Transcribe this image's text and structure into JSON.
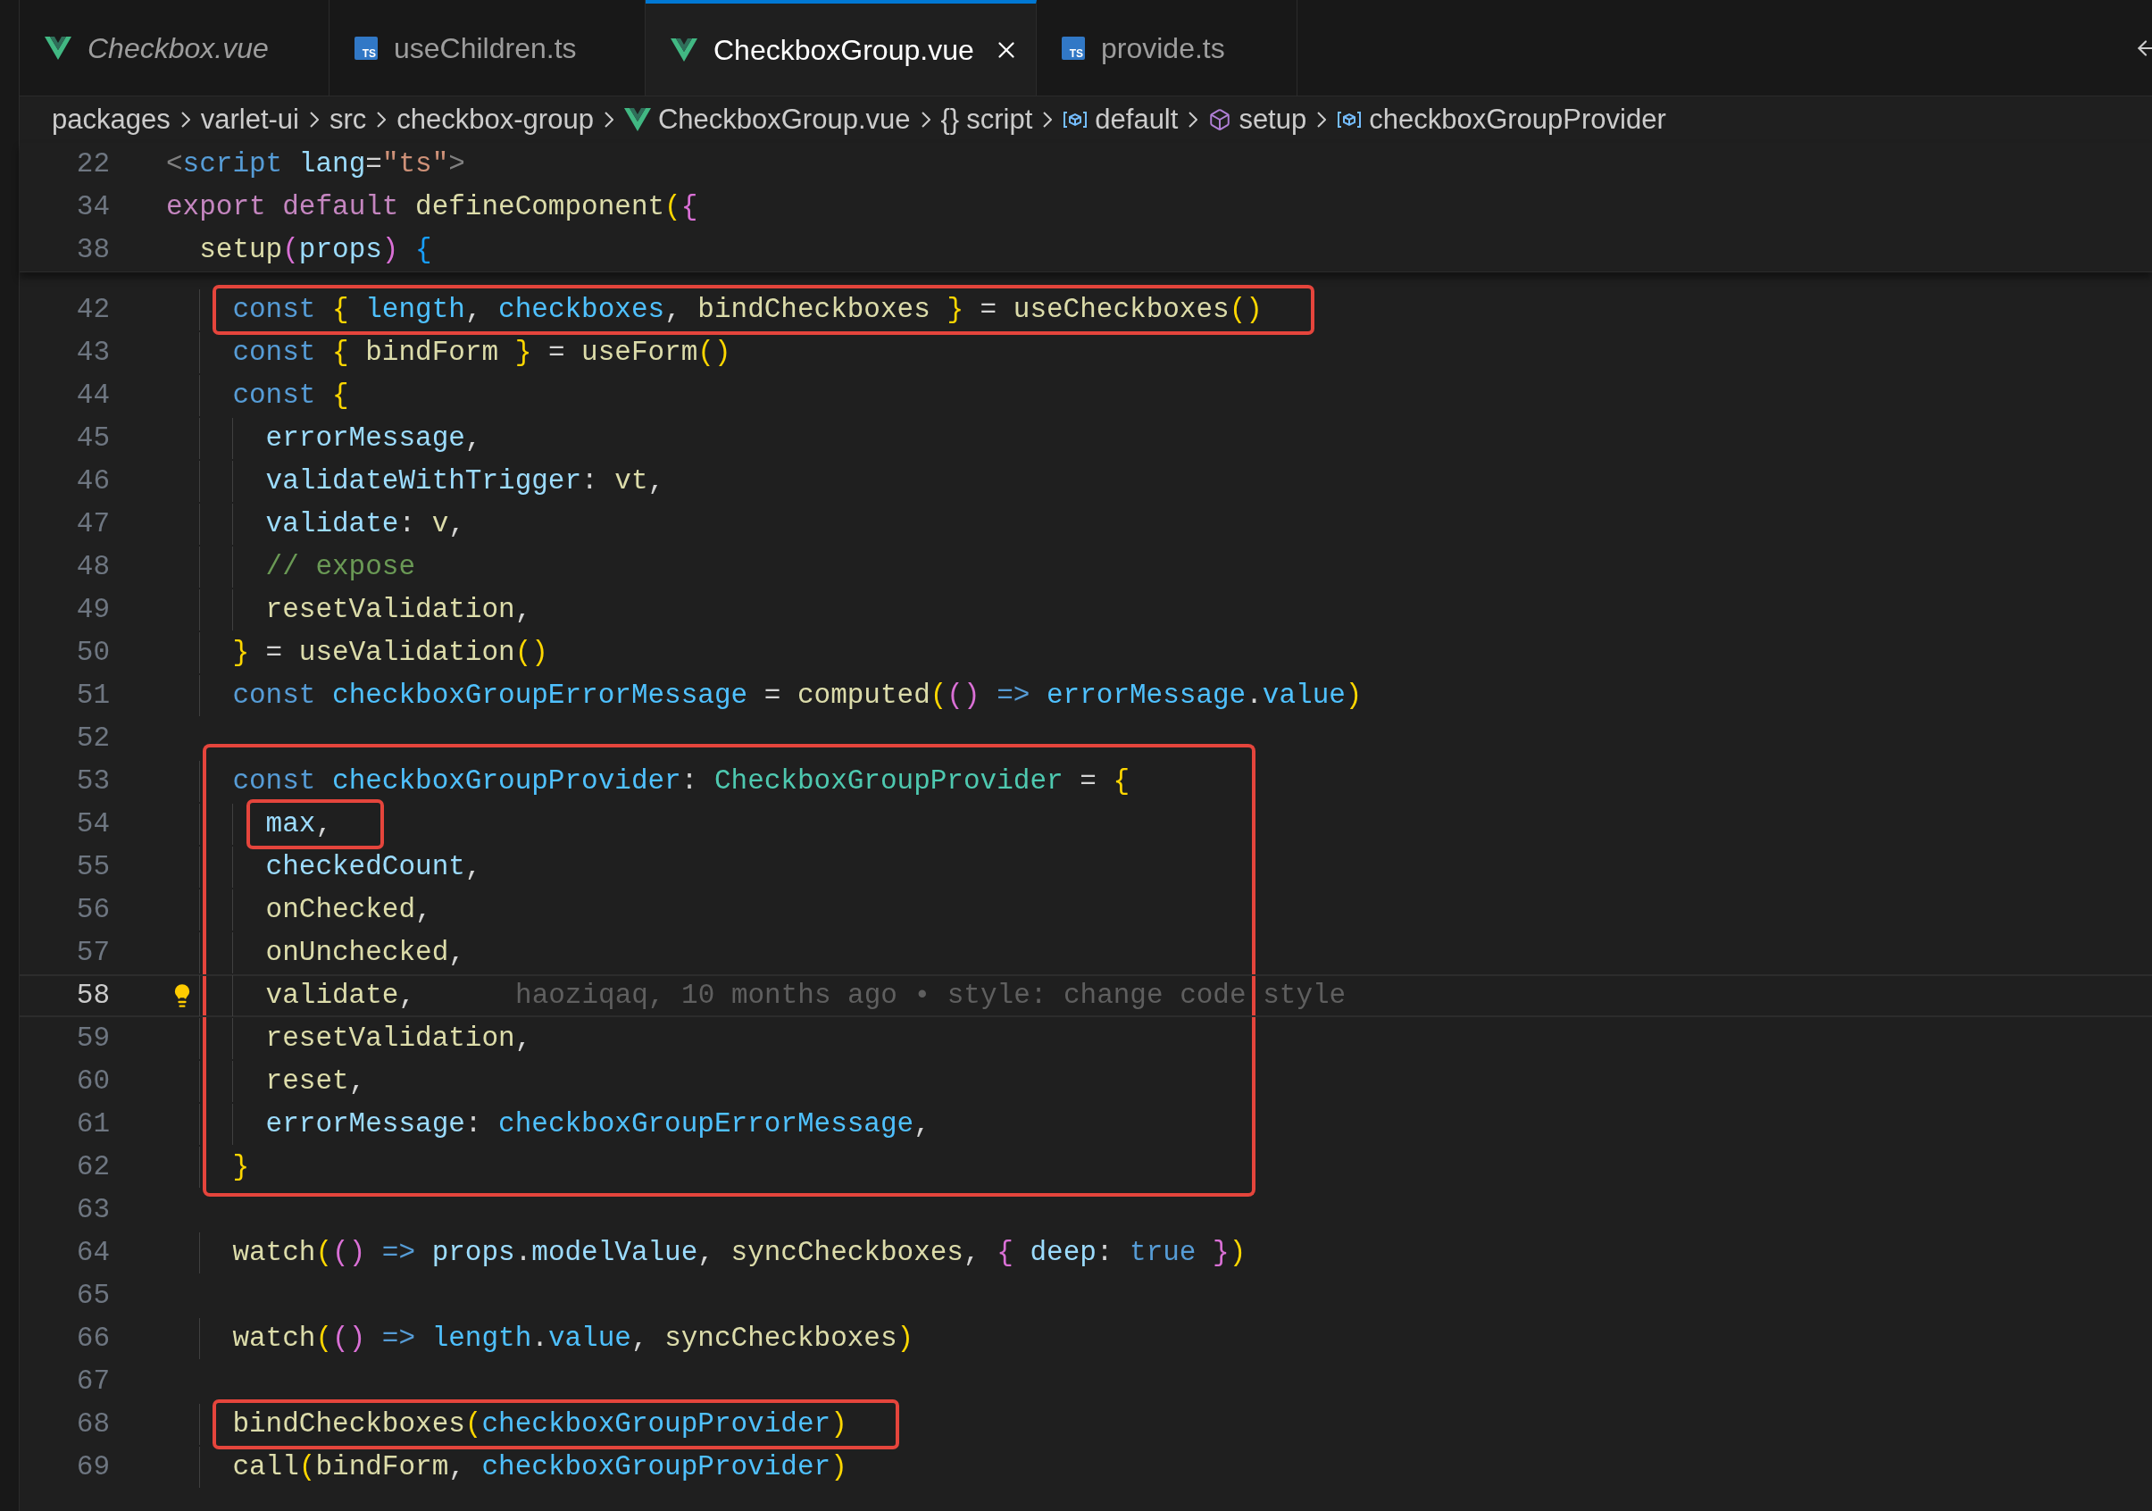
{
  "tabs": [
    {
      "label": "Checkbox.vue",
      "kind": "vue",
      "selected": false,
      "preview": true
    },
    {
      "label": "useChildren.ts",
      "kind": "ts",
      "icon_text": "TS",
      "selected": false,
      "preview": false
    },
    {
      "label": "CheckboxGroup.vue",
      "kind": "vue",
      "selected": true,
      "preview": false
    },
    {
      "label": "provide.ts",
      "kind": "ts",
      "icon_text": "TS",
      "selected": false,
      "preview": false
    }
  ],
  "breadcrumbs": [
    {
      "label": "packages",
      "kind": "folder"
    },
    {
      "label": "varlet-ui",
      "kind": "folder"
    },
    {
      "label": "src",
      "kind": "folder"
    },
    {
      "label": "checkbox-group",
      "kind": "folder"
    },
    {
      "label": "CheckboxGroup.vue",
      "kind": "vue"
    },
    {
      "label": "script",
      "kind": "block",
      "icon_text": "{}"
    },
    {
      "label": "default",
      "kind": "variable"
    },
    {
      "label": "setup",
      "kind": "method"
    },
    {
      "label": "checkboxGroupProvider",
      "kind": "variable"
    }
  ],
  "sticky_lines": [
    {
      "number": "22",
      "tokens": [
        {
          "text": "<",
          "kind": "tagp"
        },
        {
          "text": "script ",
          "kind": "kw"
        },
        {
          "text": "lang",
          "kind": "prop"
        },
        {
          "text": "=",
          "kind": "p"
        },
        {
          "text": "\"ts\"",
          "kind": "str"
        },
        {
          "text": ">",
          "kind": "tagp"
        }
      ]
    },
    {
      "number": "34",
      "tokens": [
        {
          "text": "export default ",
          "kind": "ctl"
        },
        {
          "text": "defineComponent",
          "kind": "fn"
        },
        {
          "text": "(",
          "kind": "b1"
        },
        {
          "text": "{",
          "kind": "b2"
        }
      ]
    },
    {
      "number": "38",
      "tokens": [
        {
          "text": "  setup",
          "kind": "fn"
        },
        {
          "text": "(",
          "kind": "b2"
        },
        {
          "text": "props",
          "kind": "prop"
        },
        {
          "text": ") ",
          "kind": "b2"
        },
        {
          "text": "{",
          "kind": "b3"
        }
      ]
    }
  ],
  "lines": [
    {
      "number": "42",
      "current": false,
      "marked": true,
      "in_frame": false,
      "tokens": [
        {
          "text": "    const ",
          "kind": "kw"
        },
        {
          "text": "{ ",
          "kind": "b1"
        },
        {
          "text": "length",
          "kind": "var"
        },
        {
          "text": ", ",
          "kind": "p"
        },
        {
          "text": "checkboxes",
          "kind": "var"
        },
        {
          "text": ", ",
          "kind": "p"
        },
        {
          "text": "bindCheckboxes ",
          "kind": "fn"
        },
        {
          "text": "}",
          "kind": "b1"
        },
        {
          "text": " = ",
          "kind": "p"
        },
        {
          "text": "useCheckboxes",
          "kind": "fn"
        },
        {
          "text": "()",
          "kind": "b1"
        }
      ]
    },
    {
      "number": "43",
      "current": false,
      "marked": false,
      "in_frame": false,
      "tokens": [
        {
          "text": "    const ",
          "kind": "kw"
        },
        {
          "text": "{ ",
          "kind": "b1"
        },
        {
          "text": "bindForm ",
          "kind": "fn"
        },
        {
          "text": "}",
          "kind": "b1"
        },
        {
          "text": " = ",
          "kind": "p"
        },
        {
          "text": "useForm",
          "kind": "fn"
        },
        {
          "text": "()",
          "kind": "b1"
        }
      ]
    },
    {
      "number": "44",
      "current": false,
      "marked": false,
      "in_frame": false,
      "tokens": [
        {
          "text": "    const ",
          "kind": "kw"
        },
        {
          "text": "{",
          "kind": "b1"
        }
      ]
    },
    {
      "number": "45",
      "current": false,
      "marked": false,
      "in_frame": false,
      "tokens": [
        {
          "text": "      errorMessage",
          "kind": "prop"
        },
        {
          "text": ",",
          "kind": "p"
        }
      ]
    },
    {
      "number": "46",
      "current": false,
      "marked": false,
      "in_frame": false,
      "tokens": [
        {
          "text": "      validateWithTrigger",
          "kind": "prop"
        },
        {
          "text": ": ",
          "kind": "p"
        },
        {
          "text": "vt",
          "kind": "fn"
        },
        {
          "text": ",",
          "kind": "p"
        }
      ]
    },
    {
      "number": "47",
      "current": false,
      "marked": false,
      "in_frame": false,
      "tokens": [
        {
          "text": "      validate",
          "kind": "prop"
        },
        {
          "text": ": ",
          "kind": "p"
        },
        {
          "text": "v",
          "kind": "fn"
        },
        {
          "text": ",",
          "kind": "p"
        }
      ]
    },
    {
      "number": "48",
      "current": false,
      "marked": false,
      "in_frame": false,
      "tokens": [
        {
          "text": "      // expose",
          "kind": "cm"
        }
      ]
    },
    {
      "number": "49",
      "current": false,
      "marked": false,
      "in_frame": false,
      "tokens": [
        {
          "text": "      resetValidation",
          "kind": "fn"
        },
        {
          "text": ",",
          "kind": "p"
        }
      ]
    },
    {
      "number": "50",
      "current": false,
      "marked": false,
      "in_frame": false,
      "tokens": [
        {
          "text": "    }",
          "kind": "b1"
        },
        {
          "text": " = ",
          "kind": "p"
        },
        {
          "text": "useValidation",
          "kind": "fn"
        },
        {
          "text": "()",
          "kind": "b1"
        }
      ]
    },
    {
      "number": "51",
      "current": false,
      "marked": false,
      "in_frame": false,
      "tokens": [
        {
          "text": "    const ",
          "kind": "kw"
        },
        {
          "text": "checkboxGroupErrorMessage",
          "kind": "var"
        },
        {
          "text": " = ",
          "kind": "p"
        },
        {
          "text": "computed",
          "kind": "fn"
        },
        {
          "text": "(",
          "kind": "b1"
        },
        {
          "text": "() ",
          "kind": "b2"
        },
        {
          "text": "=> ",
          "kind": "kw"
        },
        {
          "text": "errorMessage",
          "kind": "var"
        },
        {
          "text": ".",
          "kind": "p"
        },
        {
          "text": "value",
          "kind": "var"
        },
        {
          "text": ")",
          "kind": "b1"
        }
      ]
    },
    {
      "number": "52",
      "current": false,
      "marked": false,
      "in_frame": false
    },
    {
      "number": "53",
      "current": false,
      "marked": false,
      "in_frame": true,
      "tokens": [
        {
          "text": "    const ",
          "kind": "kw"
        },
        {
          "text": "checkboxGroupProvider",
          "kind": "var"
        },
        {
          "text": ": ",
          "kind": "p"
        },
        {
          "text": "CheckboxGroupProvider",
          "kind": "type"
        },
        {
          "text": " = ",
          "kind": "p"
        },
        {
          "text": "{",
          "kind": "b1"
        }
      ]
    },
    {
      "number": "54",
      "current": false,
      "marked": true,
      "in_frame": true,
      "tokens": [
        {
          "text": "      max",
          "kind": "prop"
        },
        {
          "text": ",",
          "kind": "p"
        }
      ]
    },
    {
      "number": "55",
      "current": false,
      "marked": false,
      "in_frame": true,
      "tokens": [
        {
          "text": "      checkedCount",
          "kind": "prop"
        },
        {
          "text": ",",
          "kind": "p"
        }
      ]
    },
    {
      "number": "56",
      "current": false,
      "marked": false,
      "in_frame": true,
      "tokens": [
        {
          "text": "      onChecked",
          "kind": "fn"
        },
        {
          "text": ",",
          "kind": "p"
        }
      ]
    },
    {
      "number": "57",
      "current": false,
      "marked": false,
      "in_frame": true,
      "tokens": [
        {
          "text": "      onUnchecked",
          "kind": "fn"
        },
        {
          "text": ",",
          "kind": "p"
        }
      ]
    },
    {
      "number": "58",
      "current": true,
      "marked": false,
      "in_frame": true,
      "blame": "haoziqaq, 10 months ago • style: change code style",
      "tokens": [
        {
          "text": "      validate",
          "kind": "fn"
        },
        {
          "text": ",",
          "kind": "p"
        }
      ]
    },
    {
      "number": "59",
      "current": false,
      "marked": false,
      "in_frame": true,
      "tokens": [
        {
          "text": "      resetValidation",
          "kind": "fn"
        },
        {
          "text": ",",
          "kind": "p"
        }
      ]
    },
    {
      "number": "60",
      "current": false,
      "marked": false,
      "in_frame": true,
      "tokens": [
        {
          "text": "      reset",
          "kind": "fn"
        },
        {
          "text": ",",
          "kind": "p"
        }
      ]
    },
    {
      "number": "61",
      "current": false,
      "marked": false,
      "in_frame": true,
      "tokens": [
        {
          "text": "      errorMessage",
          "kind": "prop"
        },
        {
          "text": ": ",
          "kind": "p"
        },
        {
          "text": "checkboxGroupErrorMessage",
          "kind": "var"
        },
        {
          "text": ",",
          "kind": "p"
        }
      ]
    },
    {
      "number": "62",
      "current": false,
      "marked": false,
      "in_frame": true,
      "tokens": [
        {
          "text": "    }",
          "kind": "b1"
        }
      ]
    },
    {
      "number": "63",
      "current": false,
      "marked": false,
      "in_frame": false
    },
    {
      "number": "64",
      "current": false,
      "marked": false,
      "in_frame": false,
      "tokens": [
        {
          "text": "    watch",
          "kind": "fn"
        },
        {
          "text": "(",
          "kind": "b1"
        },
        {
          "text": "() ",
          "kind": "b2"
        },
        {
          "text": "=> ",
          "kind": "kw"
        },
        {
          "text": "props",
          "kind": "prop"
        },
        {
          "text": ".",
          "kind": "p"
        },
        {
          "text": "modelValue",
          "kind": "prop"
        },
        {
          "text": ", ",
          "kind": "p"
        },
        {
          "text": "syncCheckboxes",
          "kind": "fn"
        },
        {
          "text": ", ",
          "kind": "p"
        },
        {
          "text": "{ ",
          "kind": "b2"
        },
        {
          "text": "deep",
          "kind": "prop"
        },
        {
          "text": ": ",
          "kind": "p"
        },
        {
          "text": "true ",
          "kind": "kw"
        },
        {
          "text": "}",
          "kind": "b2"
        },
        {
          "text": ")",
          "kind": "b1"
        }
      ]
    },
    {
      "number": "65",
      "current": false,
      "marked": false,
      "in_frame": false
    },
    {
      "number": "66",
      "current": false,
      "marked": false,
      "in_frame": false,
      "tokens": [
        {
          "text": "    watch",
          "kind": "fn"
        },
        {
          "text": "(",
          "kind": "b1"
        },
        {
          "text": "() ",
          "kind": "b2"
        },
        {
          "text": "=> ",
          "kind": "kw"
        },
        {
          "text": "length",
          "kind": "var"
        },
        {
          "text": ".",
          "kind": "p"
        },
        {
          "text": "value",
          "kind": "var"
        },
        {
          "text": ", ",
          "kind": "p"
        },
        {
          "text": "syncCheckboxes",
          "kind": "fn"
        },
        {
          "text": ")",
          "kind": "b1"
        }
      ]
    },
    {
      "number": "67",
      "current": false,
      "marked": false,
      "in_frame": false
    },
    {
      "number": "68",
      "current": false,
      "marked": true,
      "in_frame": false,
      "tokens": [
        {
          "text": "    bindCheckboxes",
          "kind": "fn"
        },
        {
          "text": "(",
          "kind": "b1"
        },
        {
          "text": "checkboxGroupProvider",
          "kind": "var"
        },
        {
          "text": ")",
          "kind": "b1"
        }
      ]
    },
    {
      "number": "69",
      "current": false,
      "marked": false,
      "in_frame": false,
      "tokens": [
        {
          "text": "    call",
          "kind": "fn"
        },
        {
          "text": "(",
          "kind": "b1"
        },
        {
          "text": "bindForm",
          "kind": "fn"
        },
        {
          "text": ", ",
          "kind": "p"
        },
        {
          "text": "checkboxGroupProvider",
          "kind": "var"
        },
        {
          "text": ")",
          "kind": "b1"
        }
      ]
    }
  ]
}
